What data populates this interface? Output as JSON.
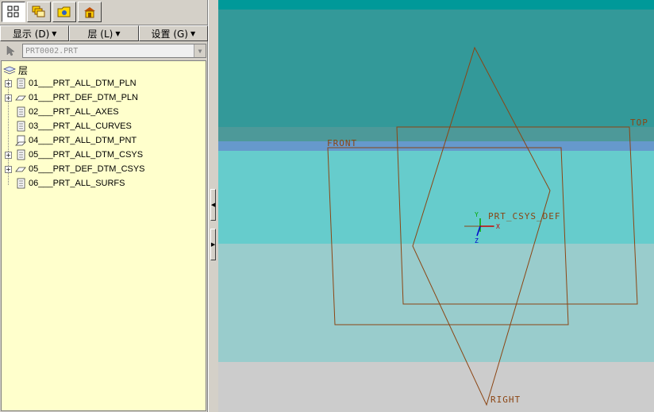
{
  "nav_tabs": [
    {
      "icon": "model-tree-icon",
      "active": true
    },
    {
      "icon": "layers-icon",
      "active": false
    },
    {
      "icon": "favorites-folder-icon",
      "active": false
    },
    {
      "icon": "connections-icon",
      "active": false
    }
  ],
  "menu": {
    "show": "显示 (D)",
    "layer": "层 (L)",
    "settings": "设置 (G)"
  },
  "model_selector": {
    "value": "PRT0002.PRT"
  },
  "tree": {
    "root_label": "层",
    "items": [
      {
        "label": "01___PRT_ALL_DTM_PLN",
        "expandable": true,
        "icon": "layer-icon"
      },
      {
        "label": "01___PRT_DEF_DTM_PLN",
        "expandable": true,
        "icon": "plane-icon"
      },
      {
        "label": "02___PRT_ALL_AXES",
        "expandable": false,
        "icon": "layer-icon"
      },
      {
        "label": "03___PRT_ALL_CURVES",
        "expandable": false,
        "icon": "layer-icon"
      },
      {
        "label": "04___PRT_ALL_DTM_PNT",
        "expandable": false,
        "icon": "plane-icon"
      },
      {
        "label": "05___PRT_ALL_DTM_CSYS",
        "expandable": true,
        "icon": "layer-icon"
      },
      {
        "label": "05___PRT_DEF_DTM_CSYS",
        "expandable": true,
        "icon": "plane-icon"
      },
      {
        "label": "06___PRT_ALL_SURFS",
        "expandable": false,
        "icon": "layer-icon"
      }
    ]
  },
  "graphics": {
    "datum_labels": {
      "top": "TOP",
      "front": "FRONT",
      "right": "RIGHT",
      "csys": "PRT_CSYS_DEF"
    },
    "csys_axes": {
      "x": "X",
      "y": "Y",
      "z": "Z"
    },
    "colors": {
      "band_dark": "#339999",
      "band_mid": "#66cccc",
      "band_light": "#99cccc",
      "band_gray": "#cccccc",
      "datum": "#8b4513",
      "accent_blue": "#6699cc"
    }
  }
}
